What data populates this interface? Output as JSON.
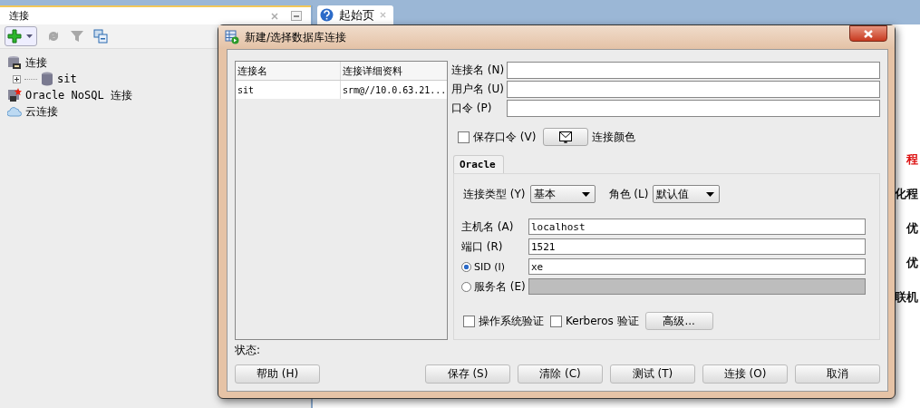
{
  "side_panel": {
    "title": "连接",
    "tree": [
      {
        "label": "连接",
        "children": [
          {
            "label": "sit",
            "expanded": false
          }
        ]
      },
      {
        "label": "Oracle NoSQL 连接"
      },
      {
        "label": "云连接"
      }
    ]
  },
  "doc_tab": {
    "label": "起始页"
  },
  "start_page_fragments": [
    {
      "text": "程",
      "color": "#dd1111"
    },
    {
      "text": "化程",
      "color": "#111111"
    },
    {
      "text": "优",
      "color": "#111111"
    },
    {
      "text": "优",
      "color": "#111111"
    },
    {
      "text": "联机",
      "color": "#111111"
    }
  ],
  "dialog": {
    "title": "新建/选择数据库连接",
    "list": {
      "columns": [
        "连接名",
        "连接详细资料"
      ],
      "rows": [
        {
          "cells": [
            "sit",
            "srm@//10.0.63.21..."
          ],
          "selected": false
        }
      ]
    },
    "fields": [
      {
        "label": "连接名 (N)"
      },
      {
        "label": "用户名 (U)"
      },
      {
        "label": "口令 (P)"
      }
    ],
    "save_password": {
      "label": "保存口令 (V)",
      "checked": false
    },
    "color_label": "连接颜色",
    "tabs": [
      {
        "label": "Oracle",
        "selected": true
      }
    ],
    "connection_type": {
      "label": "连接类型 (Y)",
      "value": "基本"
    },
    "role": {
      "label": "角色 (L)",
      "value": "默认值"
    },
    "conn_fields": [
      {
        "kind": "text",
        "label": "主机名 (A)",
        "value": "localhost",
        "disabled": false
      },
      {
        "kind": "text",
        "label": "端口 (R)",
        "value": "1521",
        "disabled": false
      },
      {
        "kind": "radio",
        "label": "SID (I)",
        "value": "xe",
        "selected": true,
        "disabled": false
      },
      {
        "kind": "radio",
        "label": "服务名 (E)",
        "selected": false,
        "disabled": true
      }
    ],
    "options": [
      {
        "label": "操作系统验证",
        "checked": false
      },
      {
        "label": "Kerberos 验证",
        "checked": false
      }
    ],
    "advanced_button": "高级...",
    "status_label": "状态:",
    "help_button": "帮助 (H)",
    "buttons": [
      "保存 (S)",
      "清除 (C)",
      "测试 (T)",
      "连接 (O)",
      "取消"
    ]
  }
}
